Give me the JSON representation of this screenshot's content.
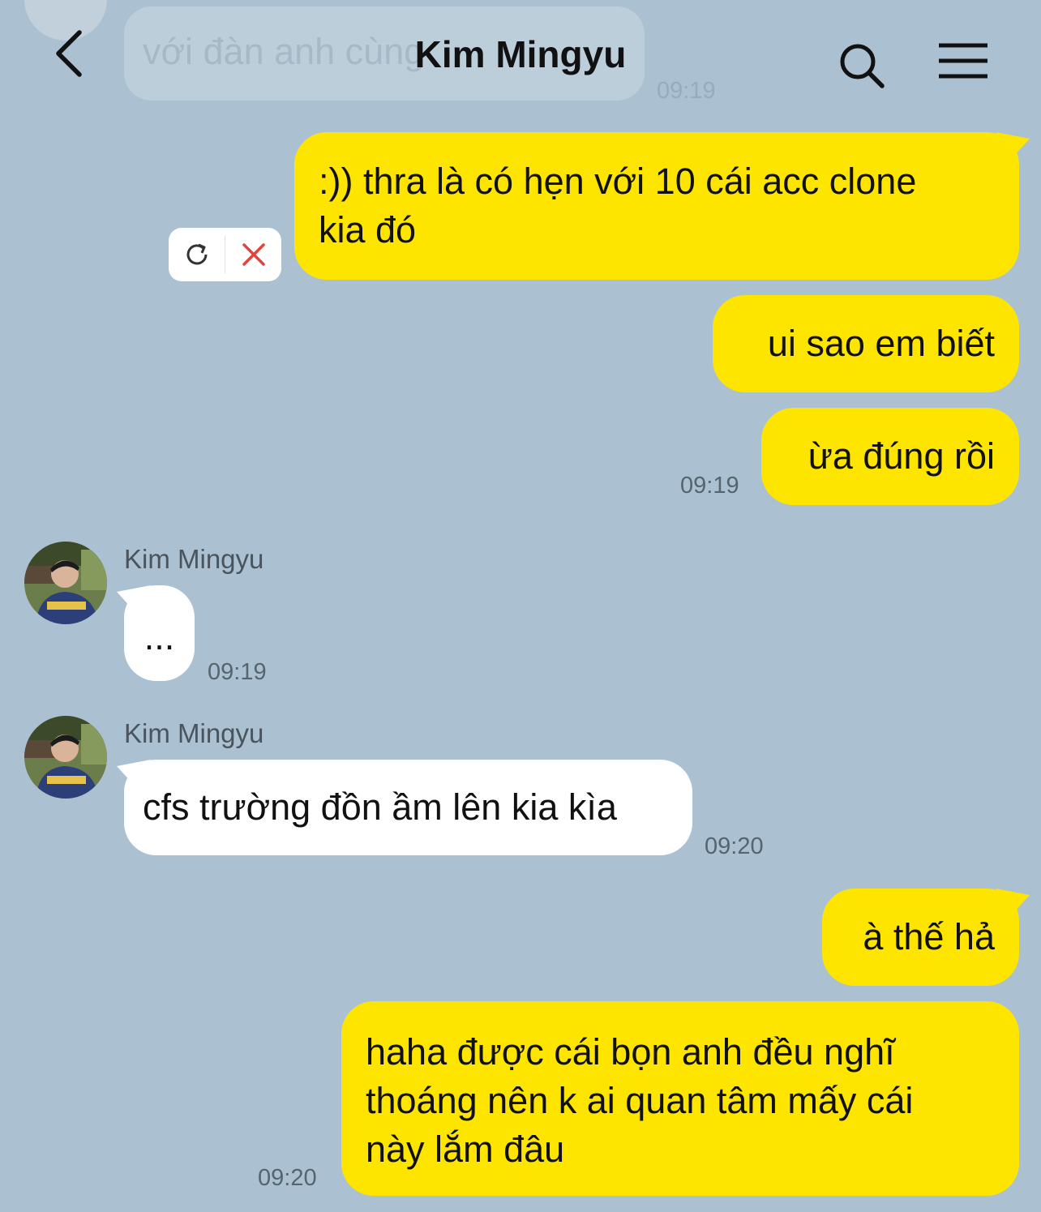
{
  "header": {
    "title": "Kim Mingyu"
  },
  "ghost_message": {
    "text": "với đàn anh cùng",
    "time": "09:19"
  },
  "messages": [
    {
      "from": "me",
      "text_lines": [
        ":)) thra là có hẹn với 10 cái acc clone",
        "kia đó"
      ],
      "status": "failed"
    },
    {
      "from": "me",
      "text": "ui sao em biết"
    },
    {
      "from": "me",
      "text": "ừa đúng rồi",
      "time": "09:19"
    },
    {
      "from": "other",
      "sender": "Kim Mingyu",
      "text": "...",
      "time": "09:19"
    },
    {
      "from": "other",
      "sender": "Kim Mingyu",
      "text": "cfs trường đồn ầm lên kia kìa",
      "time": "09:20"
    },
    {
      "from": "me",
      "text": "à thế hả"
    },
    {
      "from": "me",
      "text_lines": [
        "haha được cái bọn anh đều nghĩ",
        "thoáng nên k ai quan tâm mấy cái",
        "này lắm đâu"
      ],
      "time": "09:20"
    }
  ],
  "colors": {
    "background": "#abc1d1",
    "my_bubble": "#fee500",
    "their_bubble": "#ffffff",
    "fail_icon": "#e0443e"
  },
  "icons": [
    "back-icon",
    "search-icon",
    "menu-icon",
    "retry-icon",
    "delete-icon"
  ]
}
